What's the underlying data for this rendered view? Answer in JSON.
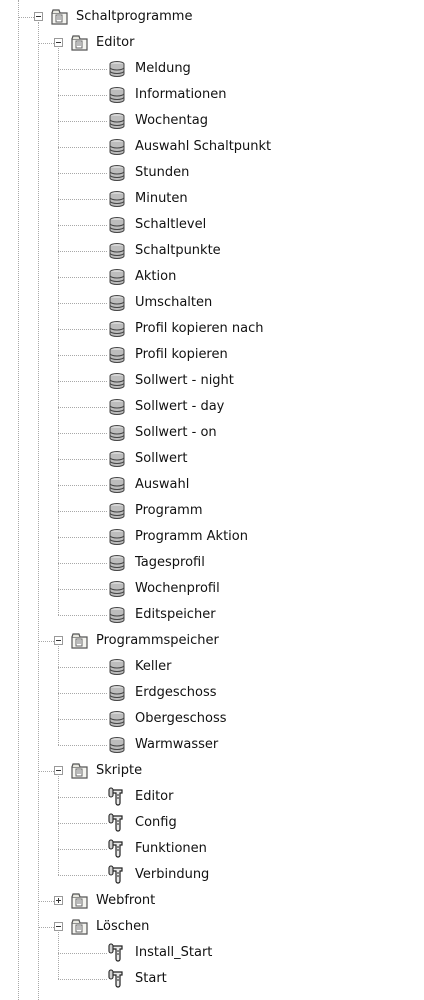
{
  "tree": {
    "nodes": [
      {
        "label": "Schaltprogramme",
        "type": "folder",
        "expanded": true
      },
      {
        "label": "Editor",
        "type": "folder",
        "expanded": true
      },
      {
        "label": "Meldung",
        "type": "variable"
      },
      {
        "label": "Informationen",
        "type": "variable"
      },
      {
        "label": "Wochentag",
        "type": "variable"
      },
      {
        "label": "Auswahl Schaltpunkt",
        "type": "variable"
      },
      {
        "label": "Stunden",
        "type": "variable"
      },
      {
        "label": "Minuten",
        "type": "variable"
      },
      {
        "label": "Schaltlevel",
        "type": "variable"
      },
      {
        "label": "Schaltpunkte",
        "type": "variable"
      },
      {
        "label": "Aktion",
        "type": "variable"
      },
      {
        "label": "Umschalten",
        "type": "variable"
      },
      {
        "label": "Profil kopieren nach",
        "type": "variable"
      },
      {
        "label": "Profil kopieren",
        "type": "variable"
      },
      {
        "label": "Sollwert - night",
        "type": "variable"
      },
      {
        "label": "Sollwert - day",
        "type": "variable"
      },
      {
        "label": "Sollwert - on",
        "type": "variable"
      },
      {
        "label": "Sollwert",
        "type": "variable"
      },
      {
        "label": "Auswahl",
        "type": "variable"
      },
      {
        "label": "Programm",
        "type": "variable"
      },
      {
        "label": "Programm Aktion",
        "type": "variable"
      },
      {
        "label": "Tagesprofil",
        "type": "variable"
      },
      {
        "label": "Wochenprofil",
        "type": "variable"
      },
      {
        "label": "Editspeicher",
        "type": "variable"
      },
      {
        "label": "Programmspeicher",
        "type": "folder",
        "expanded": true
      },
      {
        "label": "Keller",
        "type": "variable"
      },
      {
        "label": "Erdgeschoss",
        "type": "variable"
      },
      {
        "label": "Obergeschoss",
        "type": "variable"
      },
      {
        "label": "Warmwasser",
        "type": "variable"
      },
      {
        "label": "Skripte",
        "type": "folder",
        "expanded": true
      },
      {
        "label": "Editor",
        "type": "script"
      },
      {
        "label": "Config",
        "type": "script"
      },
      {
        "label": "Funktionen",
        "type": "script"
      },
      {
        "label": "Verbindung",
        "type": "script"
      },
      {
        "label": "Webfront",
        "type": "folder",
        "expanded": false
      },
      {
        "label": "Löschen",
        "type": "folder",
        "expanded": true
      },
      {
        "label": "Install_Start",
        "type": "script"
      },
      {
        "label": "Start",
        "type": "script"
      }
    ]
  },
  "colors": {
    "tree_line": "#a8a8a8",
    "text": "#111111",
    "background": "#ffffff"
  },
  "icons": {
    "folder": "folder-icon",
    "variable": "variable-icon",
    "script": "script-icon"
  }
}
